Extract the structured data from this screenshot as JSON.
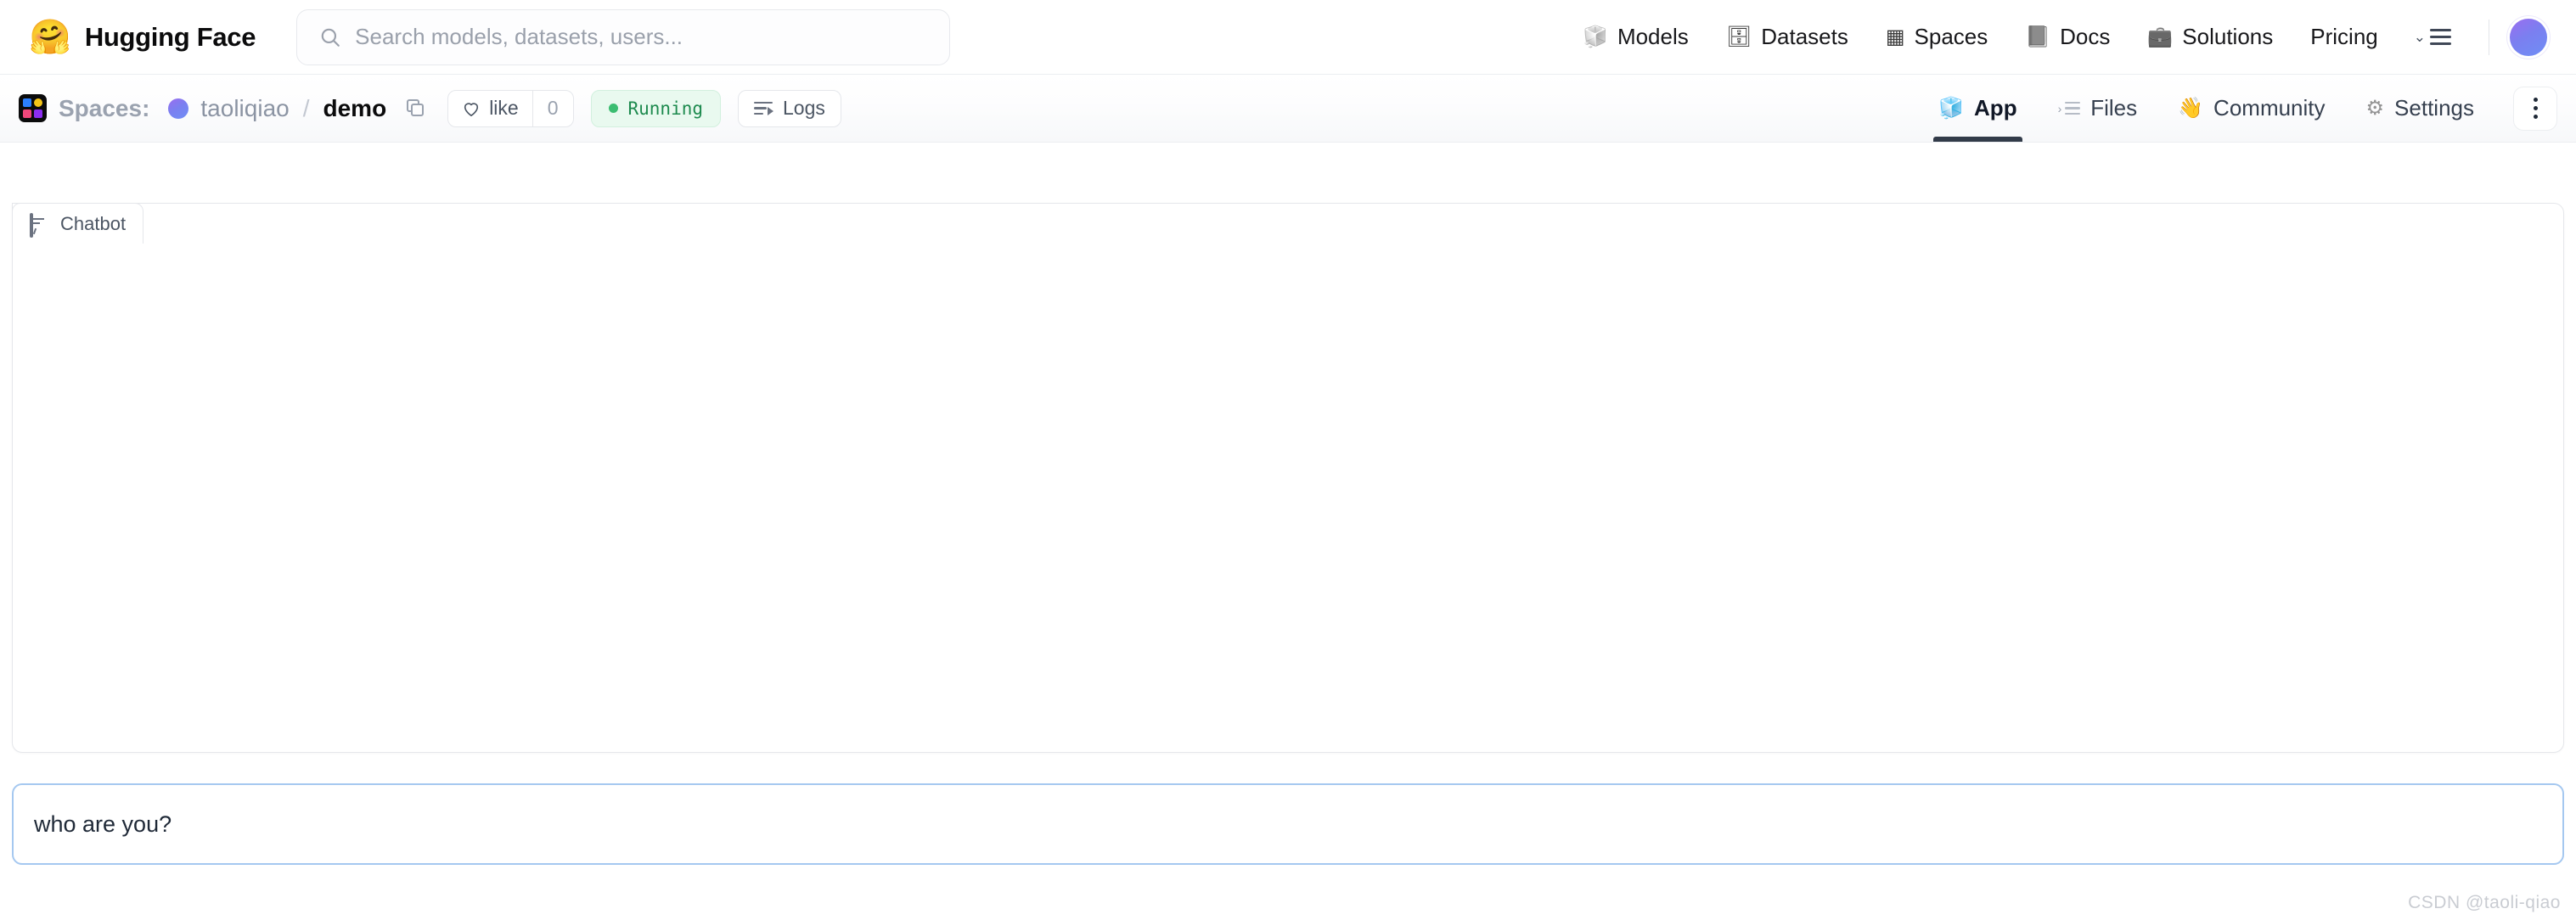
{
  "header": {
    "logo_emoji": "🤗",
    "brand": "Hugging Face",
    "search": {
      "icon": "search-icon",
      "placeholder": "Search models, datasets, users..."
    },
    "nav": [
      {
        "icon": "cube-icon",
        "emoji": "🧊",
        "label": "Models"
      },
      {
        "icon": "database-icon",
        "emoji": "🗄",
        "label": "Datasets"
      },
      {
        "icon": "spaces-grid-icon",
        "emoji": "▦",
        "label": "Spaces"
      },
      {
        "icon": "book-icon",
        "emoji": "📘",
        "label": "Docs"
      },
      {
        "icon": "briefcase-icon",
        "emoji": "💼",
        "label": "Solutions"
      },
      {
        "icon": "",
        "emoji": "",
        "label": "Pricing"
      }
    ],
    "menu_icon": "chevron-down-menu-icon",
    "avatar": "user-avatar",
    "avatar_gradient": "#7b7ff0"
  },
  "subheader": {
    "spaces_icon": "spaces-icon",
    "spaces_label": "Spaces:",
    "owner_avatar": "owner-avatar",
    "owner": "taoliqiao",
    "separator": "/",
    "repo": "demo",
    "copy_icon": "copy-icon",
    "like": {
      "icon": "heart-icon",
      "label": "like",
      "count": "0"
    },
    "status": {
      "icon": "status-dot-icon",
      "label": "Running",
      "color": "#1d8a4e",
      "bg": "#e9f9ef"
    },
    "logs": {
      "icon": "logs-icon",
      "label": "Logs"
    },
    "tabs": [
      {
        "icon": "cube-icon",
        "emoji": "🧊",
        "label": "App",
        "active": true
      },
      {
        "icon": "files-icon",
        "emoji": "",
        "label": "Files",
        "active": false
      },
      {
        "icon": "wave-hand-icon",
        "emoji": "👋",
        "label": "Community",
        "active": false
      },
      {
        "icon": "gear-icon",
        "emoji": "⚙",
        "label": "Settings",
        "active": false
      }
    ],
    "kebab_icon": "more-vertical-icon"
  },
  "app": {
    "chatbot": {
      "icon": "chat-bubble-icon",
      "label": "Chatbot",
      "messages": []
    },
    "textbox": {
      "value": "who are you?",
      "placeholder": ""
    }
  },
  "watermark": "CSDN @taoli-qiao"
}
